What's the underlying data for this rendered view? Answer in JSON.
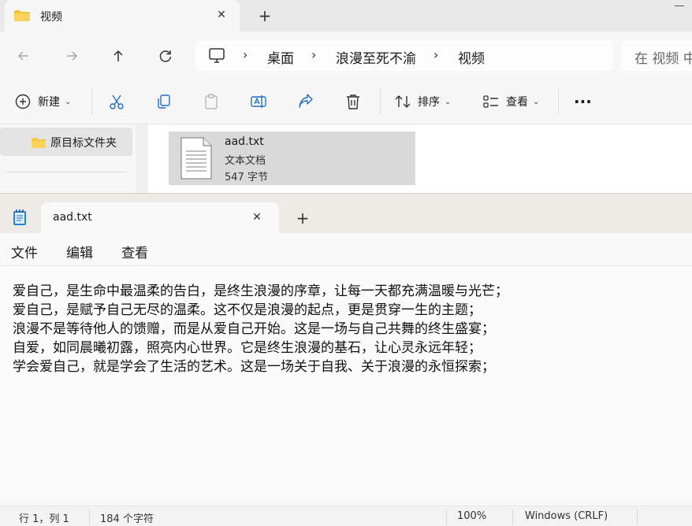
{
  "explorer": {
    "tab_title": "视频",
    "tab_close": "✕",
    "new_tab": "+",
    "breadcrumb": [
      "桌面",
      "浪漫至死不渝",
      "视频"
    ],
    "search_placeholder": "在 视频 中",
    "toolbar": {
      "new_label": "新建",
      "sort_label": "排序",
      "view_label": "查看",
      "more": "···"
    },
    "sidebar": {
      "items": [
        {
          "label": "原目标文件夹"
        }
      ]
    },
    "file": {
      "name": "aad.txt",
      "type": "文本文档",
      "size": "547 字节"
    }
  },
  "notepad": {
    "tab_title": "aad.txt",
    "tab_close": "✕",
    "new_tab": "+",
    "menu": [
      "文件",
      "编辑",
      "查看"
    ],
    "lines": [
      "爱自己，是生命中最温柔的告白，是终生浪漫的序章，让每一天都充满温暖与光芒；",
      "爱自己，是赋予自己无尽的温柔。这不仅是浪漫的起点，更是贯穿一生的主题；",
      "浪漫不是等待他人的馈赠，而是从爱自己开始。这是一场与自己共舞的终生盛宴；",
      "自爱，如同晨曦初露，照亮内心世界。它是终生浪漫的基石，让心灵永远年轻；",
      "学会爱自己，就是学会了生活的艺术。这是一场关于自我、关于浪漫的永恒探索；"
    ],
    "status": {
      "position": "行 1，列 1",
      "chars": "184 个字符",
      "zoom": "100%",
      "line_ending": "Windows (CRLF)"
    }
  }
}
